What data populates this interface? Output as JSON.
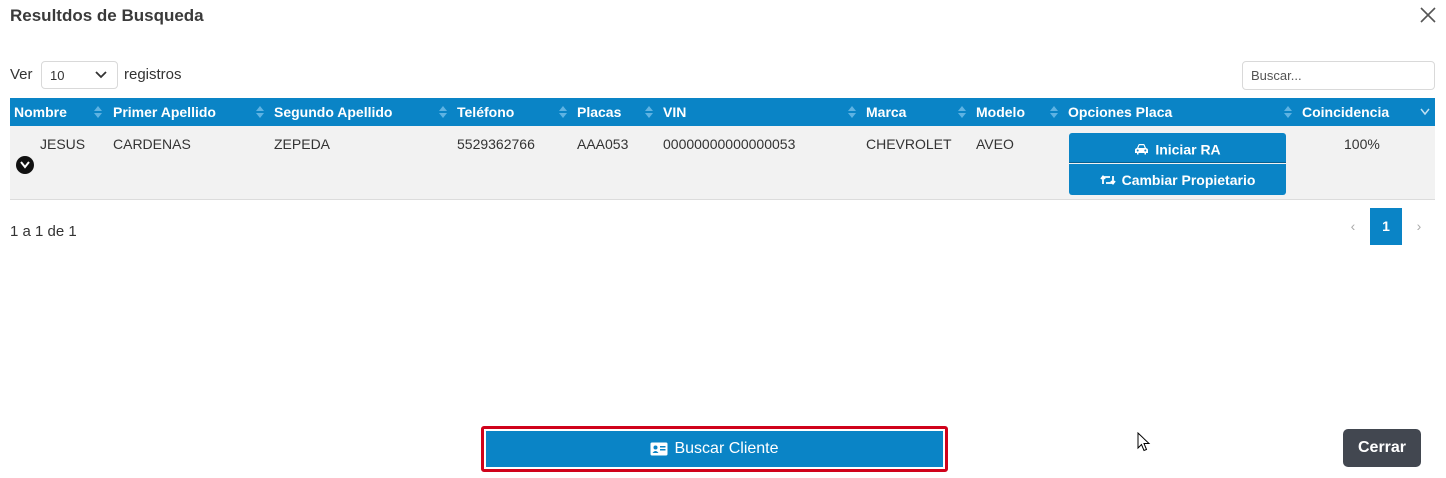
{
  "dialog": {
    "title": "Resultdos de Busqueda"
  },
  "length_control": {
    "prefix": "Ver",
    "selected": "10",
    "suffix": "registros"
  },
  "search": {
    "placeholder": "Buscar..."
  },
  "table": {
    "columns": [
      "Nombre",
      "Primer Apellido",
      "Segundo Apellido",
      "Teléfono",
      "Placas",
      "VIN",
      "Marca",
      "Modelo",
      "Opciones Placa",
      "Coincidencia"
    ],
    "rows": [
      {
        "nombre": "JESUS",
        "primer_apellido": "CARDENAS",
        "segundo_apellido": "ZEPEDA",
        "telefono": "5529362766",
        "placas": "AAA053",
        "vin": "00000000000000053",
        "marca": "CHEVROLET",
        "modelo": "AVEO",
        "opciones": {
          "iniciar_ra": "Iniciar RA",
          "cambiar_propietario": "Cambiar Propietario"
        },
        "coincidencia": "100%"
      }
    ]
  },
  "info": {
    "text": "1 a 1 de 1"
  },
  "pagination": {
    "prev": "‹",
    "current": "1",
    "next": "›"
  },
  "footer": {
    "buscar_cliente": "Buscar Cliente",
    "cerrar": "Cerrar"
  },
  "colors": {
    "primary": "#0a84c6",
    "highlight_border": "#d0021b",
    "dark_button": "#424750",
    "row_background": "#f2f2f2"
  }
}
